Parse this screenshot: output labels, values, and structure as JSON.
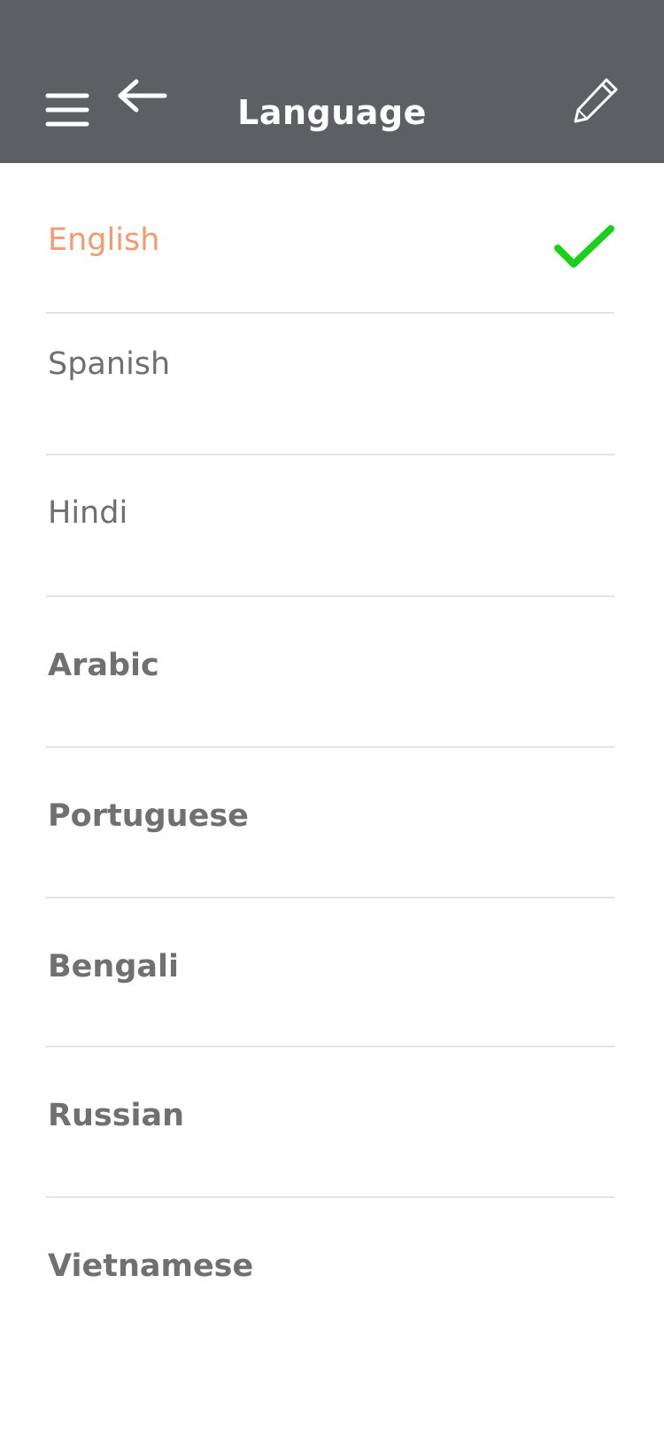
{
  "header": {
    "title": "Language",
    "menu_icon": "hamburger-menu-icon",
    "back_icon": "arrow-left-icon",
    "edit_icon": "pencil-icon",
    "background_color": "#5e5f63"
  },
  "languages": {
    "selected": "English",
    "selected_color": "#f39a70",
    "check_color": "#1ad01a",
    "items": [
      {
        "label": "English"
      },
      {
        "label": "Spanish"
      },
      {
        "label": "Hindi"
      },
      {
        "label": "Arabic"
      },
      {
        "label": "Portuguese"
      },
      {
        "label": "Bengali"
      },
      {
        "label": "Russian"
      },
      {
        "label": "Vietnamese"
      }
    ]
  }
}
